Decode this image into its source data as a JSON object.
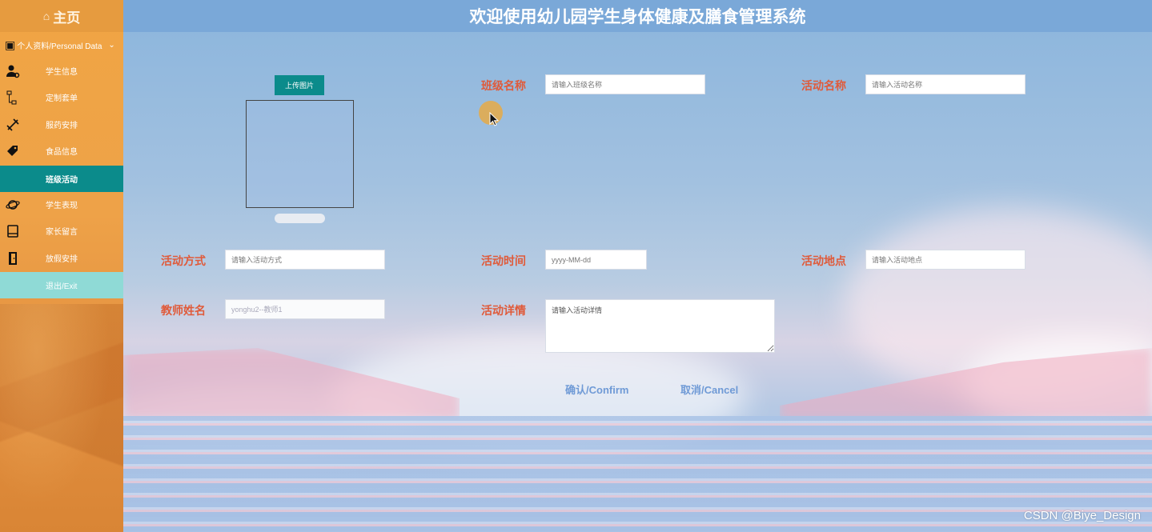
{
  "sidebar": {
    "home_label": "主页",
    "group_label": "个人资料/Personal Data",
    "items": [
      {
        "label": "学生信息",
        "icon": "user-gear-icon"
      },
      {
        "label": "定制套单",
        "icon": "sitemap-icon"
      },
      {
        "label": "服药安排",
        "icon": "pencil-ruler-icon"
      },
      {
        "label": "食品信息",
        "icon": "tags-icon"
      },
      {
        "label": "班级活动",
        "icon": "none",
        "active": true
      },
      {
        "label": "学生表现",
        "icon": "planet-icon"
      },
      {
        "label": "家长留言",
        "icon": "book-icon"
      },
      {
        "label": "放假安排",
        "icon": "door-icon"
      },
      {
        "label": "退出/Exit",
        "icon": "none"
      }
    ]
  },
  "header": {
    "title": "欢迎使用幼儿园学生身体健康及膳食管理系统"
  },
  "form": {
    "upload_button": "上传图片",
    "class_name": {
      "label": "班级名称",
      "placeholder": "请输入班级名称"
    },
    "activity_name": {
      "label": "活动名称",
      "placeholder": "请输入活动名称"
    },
    "activity_method": {
      "label": "活动方式",
      "placeholder": "请输入活动方式"
    },
    "activity_time": {
      "label": "活动时间",
      "placeholder": "yyyy-MM-dd"
    },
    "activity_place": {
      "label": "活动地点",
      "placeholder": "请输入活动地点"
    },
    "teacher_name": {
      "label": "教师姓名",
      "value": "yonghu2--教师1"
    },
    "activity_detail": {
      "label": "活动详情",
      "placeholder": "请输入活动详情"
    },
    "confirm_button": "确认/Confirm",
    "cancel_button": "取消/Cancel"
  },
  "watermark": "CSDN @Biye_Design",
  "colors": {
    "sidebar": "#f0a544",
    "active": "#0b8b8b",
    "exit": "#8fdad6",
    "header": "#7aa8d8",
    "label": "#e05a3a",
    "action": "#6f9ad6"
  }
}
